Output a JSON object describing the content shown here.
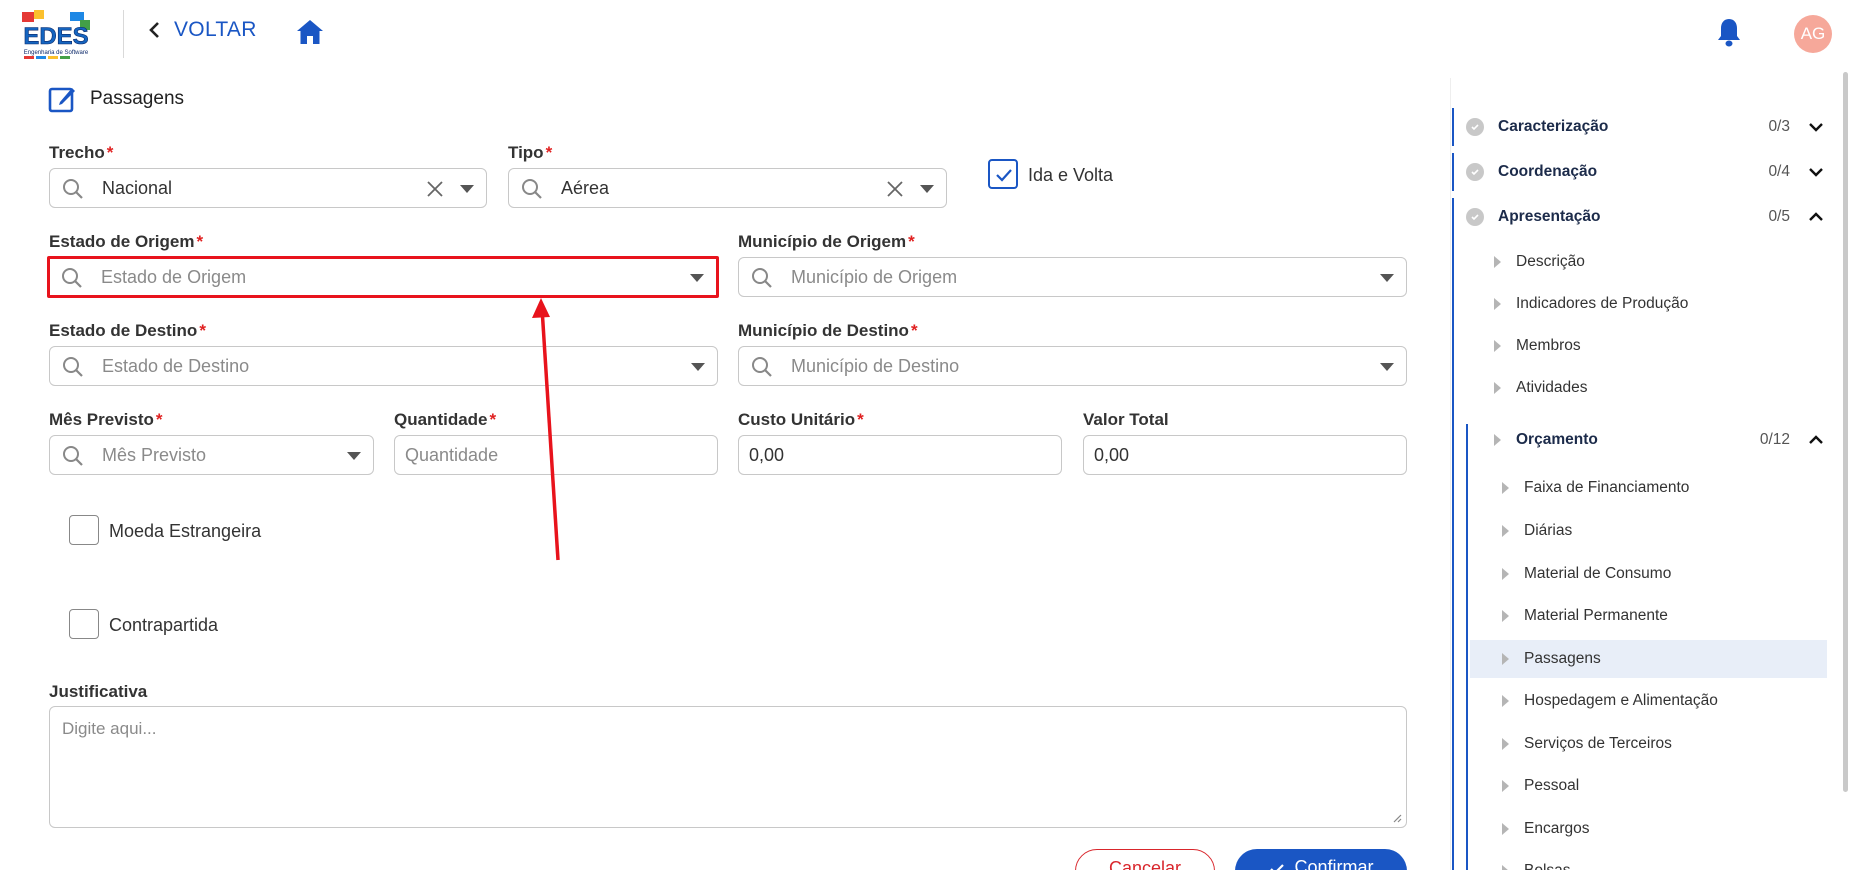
{
  "header": {
    "logo_text": "EDES",
    "logo_subtext": "Engenharia de Software",
    "back_label": "VOLTAR",
    "avatar_initials": "AG"
  },
  "section": {
    "title": "Passagens"
  },
  "form": {
    "trecho": {
      "label": "Trecho",
      "value": "Nacional"
    },
    "tipo": {
      "label": "Tipo",
      "value": "Aérea"
    },
    "ida_volta": {
      "label": "Ida e Volta",
      "checked": true
    },
    "estado_origem": {
      "label": "Estado de Origem",
      "placeholder": "Estado de Origem"
    },
    "municipio_origem": {
      "label": "Município de Origem",
      "placeholder": "Município de Origem"
    },
    "estado_destino": {
      "label": "Estado de Destino",
      "placeholder": "Estado de Destino"
    },
    "municipio_destino": {
      "label": "Município de Destino",
      "placeholder": "Município de Destino"
    },
    "mes_previsto": {
      "label": "Mês Previsto",
      "placeholder": "Mês Previsto"
    },
    "quantidade": {
      "label": "Quantidade",
      "placeholder": "Quantidade"
    },
    "custo_unitario": {
      "label": "Custo Unitário",
      "value": "0,00"
    },
    "valor_total": {
      "label": "Valor Total",
      "value": "0,00"
    },
    "moeda_estrangeira": {
      "label": "Moeda Estrangeira",
      "checked": false
    },
    "contrapartida": {
      "label": "Contrapartida",
      "checked": false
    },
    "justificativa": {
      "label": "Justificativa",
      "placeholder": "Digite aqui..."
    },
    "required_mark": "*"
  },
  "actions": {
    "cancel": "Cancelar",
    "confirm": "Confirmar"
  },
  "sidebar": {
    "sections": [
      {
        "label": "Caracterização",
        "count": "0/3",
        "expanded": false
      },
      {
        "label": "Coordenação",
        "count": "0/4",
        "expanded": false
      },
      {
        "label": "Apresentação",
        "count": "0/5",
        "expanded": true
      }
    ],
    "apresentacao_items": [
      "Descrição",
      "Indicadores de Produção",
      "Membros",
      "Atividades"
    ],
    "orcamento": {
      "label": "Orçamento",
      "count": "0/12",
      "expanded": true
    },
    "orcamento_items": [
      "Faixa de Financiamento",
      "Diárias",
      "Material de Consumo",
      "Material Permanente",
      "Passagens",
      "Hospedagem e Alimentação",
      "Serviços de Terceiros",
      "Pessoal",
      "Encargos",
      "Bolsas"
    ],
    "active_item": "Passagens"
  },
  "colors": {
    "primary": "#1a56c4",
    "required": "#e02020",
    "highlight": "#e8131c",
    "avatar": "#f6a89a",
    "active_bg": "#e8eef8"
  }
}
